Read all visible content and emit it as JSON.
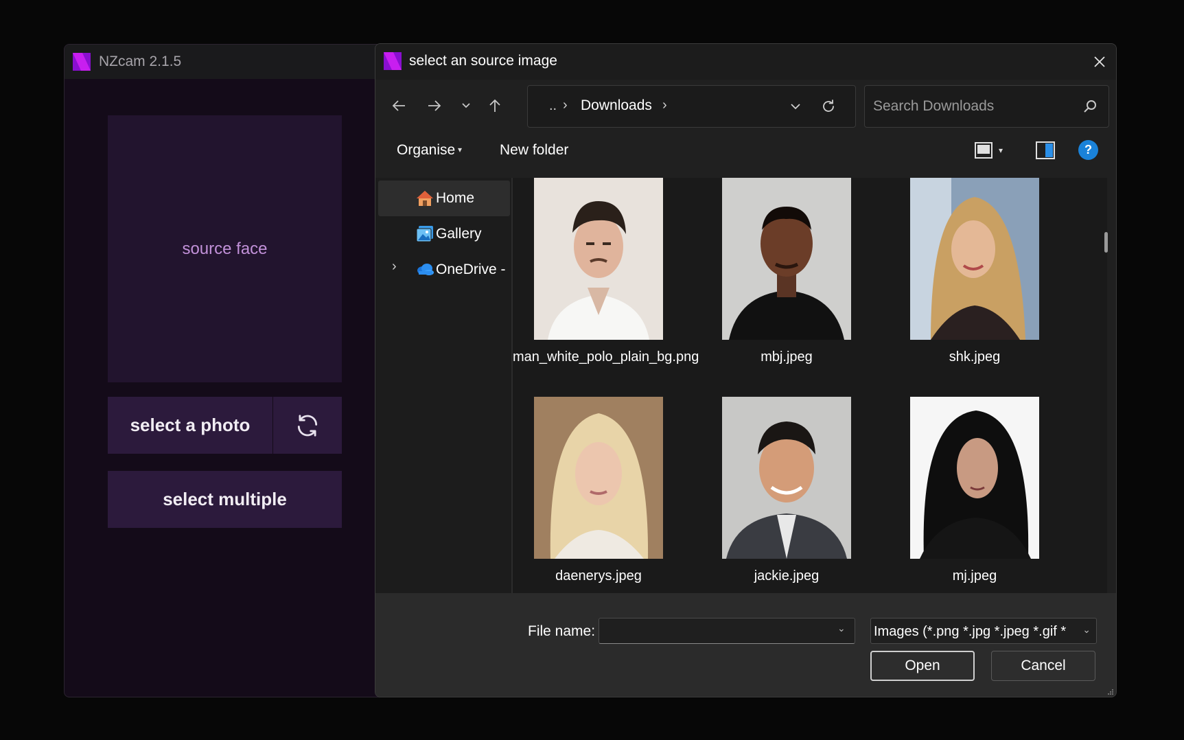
{
  "app": {
    "title": "NZcam 2.1.5",
    "preview_label": "source face",
    "select_photo_label": "select a photo",
    "select_multiple_label": "select multiple",
    "accent": "#b314e0"
  },
  "dialog": {
    "title": "select an source image",
    "address": {
      "prefix": "..",
      "segment": "Downloads"
    },
    "search_placeholder": "Search Downloads",
    "toolbar": {
      "organise_label": "Organise",
      "new_folder_label": "New folder",
      "help_label": "?"
    },
    "sidebar": [
      {
        "label": "Home",
        "icon": "home-icon"
      },
      {
        "label": "Gallery",
        "icon": "gallery-icon"
      },
      {
        "label": "OneDrive -",
        "icon": "onedrive-icon"
      }
    ],
    "files": [
      {
        "name": "man_white_polo_plain_bg.png"
      },
      {
        "name": "mbj.jpeg"
      },
      {
        "name": "shk.jpeg"
      },
      {
        "name": "daenerys.jpeg"
      },
      {
        "name": "jackie.jpeg"
      },
      {
        "name": "mj.jpeg"
      }
    ],
    "footer": {
      "file_name_label": "File name:",
      "file_name_value": "",
      "file_type": "Images (*.png *.jpg *.jpeg *.gif *",
      "open_label": "Open",
      "cancel_label": "Cancel"
    }
  }
}
